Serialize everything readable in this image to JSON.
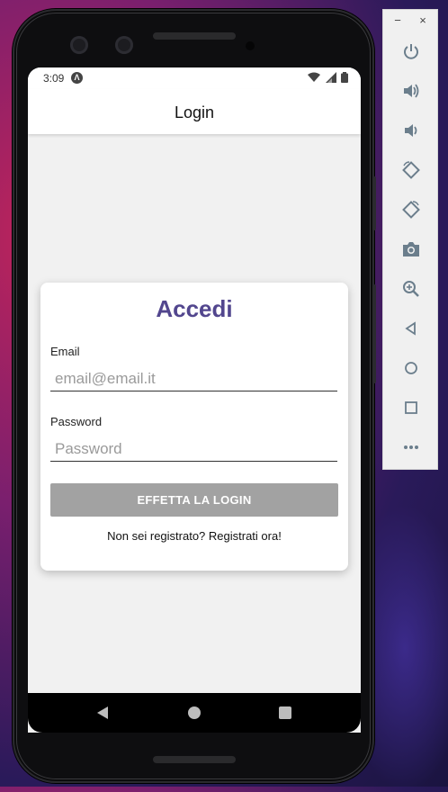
{
  "status_bar": {
    "time": "3:09",
    "app_icon": "expo-icon",
    "icons": [
      "wifi-icon",
      "signal-icon",
      "battery-icon"
    ]
  },
  "header": {
    "title": "Login"
  },
  "login_card": {
    "title": "Accedi",
    "email": {
      "label": "Email",
      "placeholder": "email@email.it",
      "value": ""
    },
    "password": {
      "label": "Password",
      "placeholder": "Password",
      "value": ""
    },
    "login_button": "EFFETTA LA LOGIN",
    "register_link": "Non sei registrato? Registrati ora!"
  },
  "nav_bar": {
    "buttons": [
      "back-icon",
      "home-icon",
      "recents-icon"
    ]
  },
  "emulator_panel": {
    "window_controls": {
      "minimize": "−",
      "close": "×"
    },
    "buttons": [
      "power-icon",
      "volume-up-icon",
      "volume-down-icon",
      "rotate-left-icon",
      "rotate-right-icon",
      "camera-icon",
      "zoom-icon",
      "back-icon",
      "home-icon",
      "overview-icon",
      "more-icon"
    ]
  },
  "colors": {
    "accent": "#52468e",
    "button_disabled": "#a2a2a2",
    "emulator_icon": "#6b7e8c"
  }
}
